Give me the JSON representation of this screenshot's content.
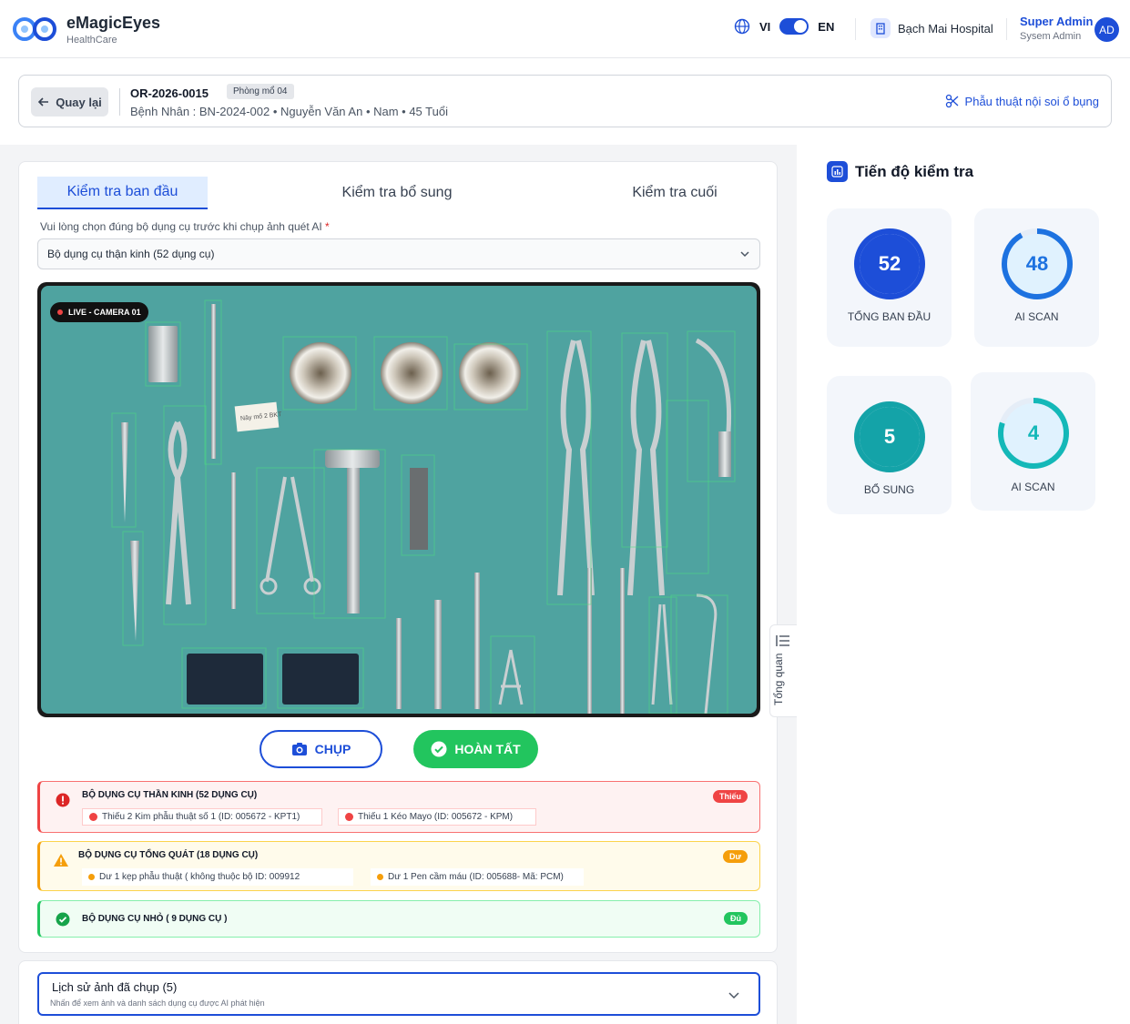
{
  "header": {
    "brand_name": "eMagicEyes",
    "brand_sub": "HealthCare",
    "lang_vi": "VI",
    "lang_en": "EN",
    "hospital": "Bạch Mai Hospital",
    "user_name": "Super Admin",
    "user_role": "Sysem Admin",
    "avatar": "AD"
  },
  "patient_bar": {
    "back_label": "Quay lại",
    "case_id": "OR-2026-0015",
    "room": "Phòng mổ 04",
    "patient_info": "Bệnh Nhân : BN-2024-002 • Nguyễn Văn An • Nam • 45 Tuổi",
    "procedure": "Phẫu thuật nội soi ổ bụng"
  },
  "tabs": [
    "Kiểm tra ban đầu",
    "Kiểm tra bổ sung",
    "Kiểm tra cuối"
  ],
  "active_tab": 0,
  "select": {
    "label": "Vui lòng chọn đúng bộ dụng cụ trước khi chụp ảnh quét AI",
    "required_mark": "*",
    "value": "Bộ dụng cụ thận kinh (52 dụng cụ)"
  },
  "camera": {
    "live_label": "LIVE - CAMERA 01",
    "tag_text": "Nây mổ 2 BKT"
  },
  "actions": {
    "capture": "CHỤP",
    "complete": "HOÀN TẤT"
  },
  "alerts": {
    "missing": {
      "title": "BỘ DỤNG CỤ THẦN KINH (52 DỤNG CỤ)",
      "badge": "Thiếu",
      "items": [
        "Thiếu 2 Kim phẫu thuật số 1 (ID: 005672 - KPT1)",
        "Thiếu 1 Kéo Mayo (ID: 005672 - KPM)"
      ]
    },
    "extra": {
      "title": "BỘ DỤNG CỤ TỔNG QUÁT (18 DỤNG CỤ)",
      "badge": "Dư",
      "items": [
        "Dư 1 kẹp phẫu thuật ( không thuộc bộ ID: 009912",
        "Dư 1 Pen cầm máu (ID: 005688- Mã: PCM)"
      ]
    },
    "ok": {
      "title": "BỘ DỤNG CỤ NHỎ ( 9 DỤNG CỤ )",
      "badge": "Đủ"
    }
  },
  "history": {
    "title": "Lịch sử ảnh đã chụp (5)",
    "subtitle": "Nhấn để xem ảnh và danh sách dụng cụ được AI phát hiện"
  },
  "side_tab": "Tổng quan",
  "progress": {
    "title": "Tiến độ kiểm tra",
    "stats": [
      {
        "value": "52",
        "label": "TỔNG BAN ĐẦU",
        "fill": 1.0,
        "color": "#1d4ed8",
        "style": "solid"
      },
      {
        "value": "48",
        "label": "AI SCAN",
        "fill": 0.92,
        "color": "#1d72e0",
        "style": "ring"
      },
      {
        "value": "5",
        "label": "BỔ SUNG",
        "fill": 1.0,
        "color": "#14a3a8",
        "style": "solid"
      },
      {
        "value": "4",
        "label": "AI SCAN",
        "fill": 0.8,
        "color": "#14b8b8",
        "style": "ring"
      }
    ]
  },
  "colors": {
    "primary": "#1d4ed8",
    "success": "#22c55e",
    "danger": "#ef4444",
    "warning": "#f59e0b",
    "teal": "#14a3a8"
  }
}
